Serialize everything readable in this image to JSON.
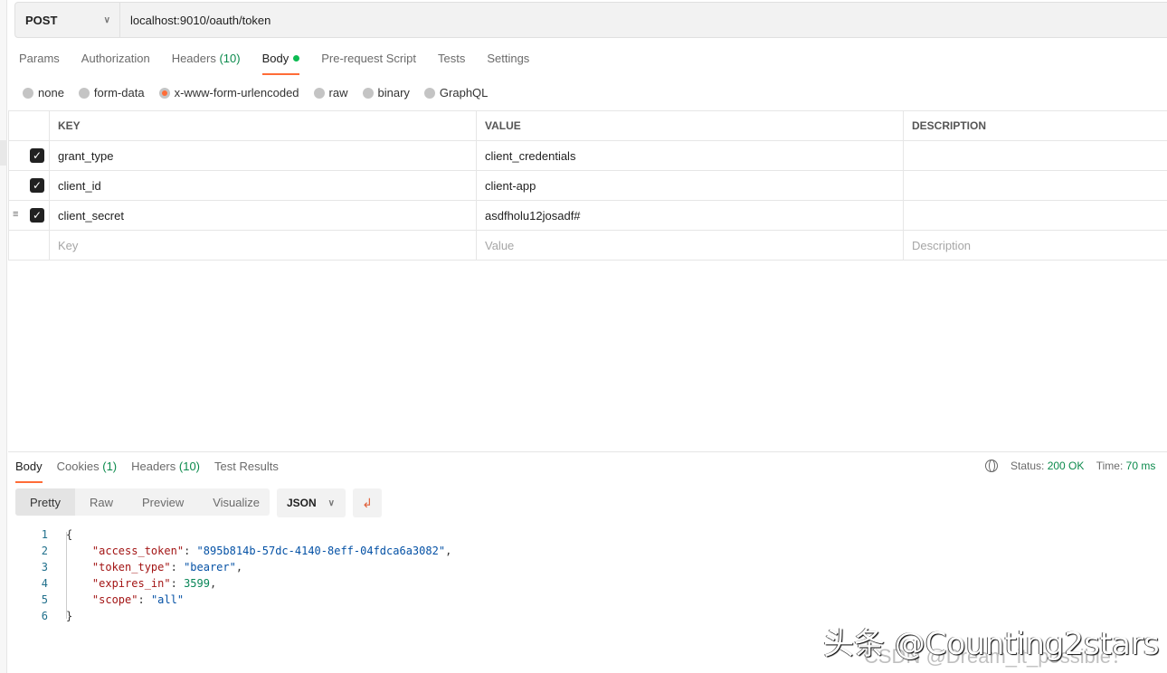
{
  "request": {
    "method": "POST",
    "url": "localhost:9010/oauth/token"
  },
  "tabs": [
    {
      "label": "Params"
    },
    {
      "label": "Authorization"
    },
    {
      "label": "Headers",
      "count": "(10)"
    },
    {
      "label": "Body"
    },
    {
      "label": "Pre-request Script"
    },
    {
      "label": "Tests"
    },
    {
      "label": "Settings"
    }
  ],
  "body_types": [
    "none",
    "form-data",
    "x-www-form-urlencoded",
    "raw",
    "binary",
    "GraphQL"
  ],
  "body_type_selected": "x-www-form-urlencoded",
  "table": {
    "headers": [
      "KEY",
      "VALUE",
      "DESCRIPTION"
    ],
    "rows": [
      {
        "key": "grant_type",
        "value": "client_credentials",
        "checked": true
      },
      {
        "key": "client_id",
        "value": "client-app",
        "checked": true
      },
      {
        "key": "client_secret",
        "value": "asdfholu12josadf#",
        "checked": true
      }
    ],
    "placeholders": {
      "key": "Key",
      "value": "Value",
      "description": "Description"
    }
  },
  "response": {
    "tabs": [
      {
        "label": "Body"
      },
      {
        "label": "Cookies",
        "count": "(1)"
      },
      {
        "label": "Headers",
        "count": "(10)"
      },
      {
        "label": "Test Results"
      }
    ],
    "status_label": "Status:",
    "status": "200 OK",
    "time_label": "Time:",
    "time": "70 ms",
    "views": [
      "Pretty",
      "Raw",
      "Preview",
      "Visualize"
    ],
    "format": "JSON",
    "lines": [
      "1",
      "2",
      "3",
      "4",
      "5",
      "6"
    ],
    "json": {
      "open": "{",
      "close": "}",
      "k1": "\"access_token\"",
      "v1": "\"895b814b-57dc-4140-8eff-04fdca6a3082\"",
      "k2": "\"token_type\"",
      "v2": "\"bearer\"",
      "k3": "\"expires_in\"",
      "v3": "3599",
      "k4": "\"scope\"",
      "v4": "\"all\""
    }
  },
  "watermarks": [
    "头条 @Counting2stars",
    "CSDN @Dream_it_possible！"
  ],
  "colors": {
    "accent": "#ff6c37",
    "success": "#0b8a4c"
  }
}
